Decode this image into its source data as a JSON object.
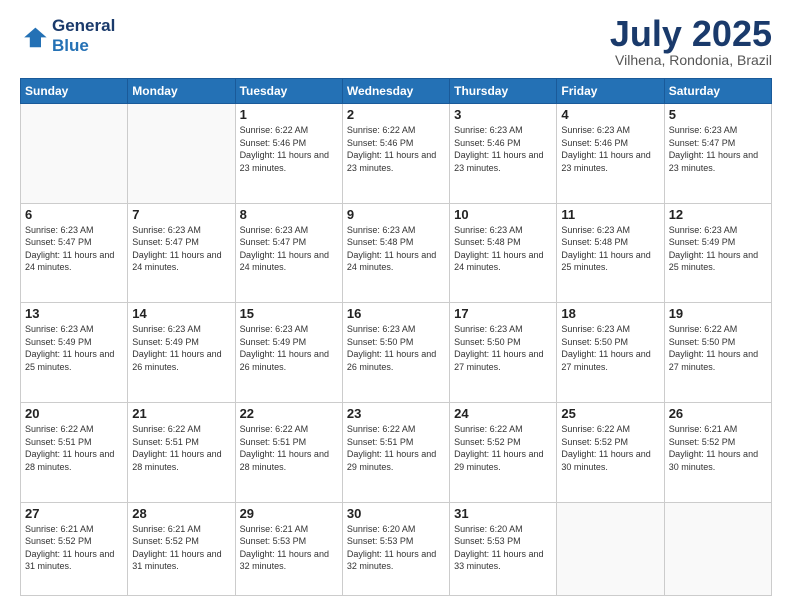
{
  "logo": {
    "line1": "General",
    "line2": "Blue"
  },
  "header": {
    "month": "July 2025",
    "location": "Vilhena, Rondonia, Brazil"
  },
  "weekdays": [
    "Sunday",
    "Monday",
    "Tuesday",
    "Wednesday",
    "Thursday",
    "Friday",
    "Saturday"
  ],
  "weeks": [
    [
      {
        "day": "",
        "info": ""
      },
      {
        "day": "",
        "info": ""
      },
      {
        "day": "1",
        "info": "Sunrise: 6:22 AM\nSunset: 5:46 PM\nDaylight: 11 hours and 23 minutes."
      },
      {
        "day": "2",
        "info": "Sunrise: 6:22 AM\nSunset: 5:46 PM\nDaylight: 11 hours and 23 minutes."
      },
      {
        "day": "3",
        "info": "Sunrise: 6:23 AM\nSunset: 5:46 PM\nDaylight: 11 hours and 23 minutes."
      },
      {
        "day": "4",
        "info": "Sunrise: 6:23 AM\nSunset: 5:46 PM\nDaylight: 11 hours and 23 minutes."
      },
      {
        "day": "5",
        "info": "Sunrise: 6:23 AM\nSunset: 5:47 PM\nDaylight: 11 hours and 23 minutes."
      }
    ],
    [
      {
        "day": "6",
        "info": "Sunrise: 6:23 AM\nSunset: 5:47 PM\nDaylight: 11 hours and 24 minutes."
      },
      {
        "day": "7",
        "info": "Sunrise: 6:23 AM\nSunset: 5:47 PM\nDaylight: 11 hours and 24 minutes."
      },
      {
        "day": "8",
        "info": "Sunrise: 6:23 AM\nSunset: 5:47 PM\nDaylight: 11 hours and 24 minutes."
      },
      {
        "day": "9",
        "info": "Sunrise: 6:23 AM\nSunset: 5:48 PM\nDaylight: 11 hours and 24 minutes."
      },
      {
        "day": "10",
        "info": "Sunrise: 6:23 AM\nSunset: 5:48 PM\nDaylight: 11 hours and 24 minutes."
      },
      {
        "day": "11",
        "info": "Sunrise: 6:23 AM\nSunset: 5:48 PM\nDaylight: 11 hours and 25 minutes."
      },
      {
        "day": "12",
        "info": "Sunrise: 6:23 AM\nSunset: 5:49 PM\nDaylight: 11 hours and 25 minutes."
      }
    ],
    [
      {
        "day": "13",
        "info": "Sunrise: 6:23 AM\nSunset: 5:49 PM\nDaylight: 11 hours and 25 minutes."
      },
      {
        "day": "14",
        "info": "Sunrise: 6:23 AM\nSunset: 5:49 PM\nDaylight: 11 hours and 26 minutes."
      },
      {
        "day": "15",
        "info": "Sunrise: 6:23 AM\nSunset: 5:49 PM\nDaylight: 11 hours and 26 minutes."
      },
      {
        "day": "16",
        "info": "Sunrise: 6:23 AM\nSunset: 5:50 PM\nDaylight: 11 hours and 26 minutes."
      },
      {
        "day": "17",
        "info": "Sunrise: 6:23 AM\nSunset: 5:50 PM\nDaylight: 11 hours and 27 minutes."
      },
      {
        "day": "18",
        "info": "Sunrise: 6:23 AM\nSunset: 5:50 PM\nDaylight: 11 hours and 27 minutes."
      },
      {
        "day": "19",
        "info": "Sunrise: 6:22 AM\nSunset: 5:50 PM\nDaylight: 11 hours and 27 minutes."
      }
    ],
    [
      {
        "day": "20",
        "info": "Sunrise: 6:22 AM\nSunset: 5:51 PM\nDaylight: 11 hours and 28 minutes."
      },
      {
        "day": "21",
        "info": "Sunrise: 6:22 AM\nSunset: 5:51 PM\nDaylight: 11 hours and 28 minutes."
      },
      {
        "day": "22",
        "info": "Sunrise: 6:22 AM\nSunset: 5:51 PM\nDaylight: 11 hours and 28 minutes."
      },
      {
        "day": "23",
        "info": "Sunrise: 6:22 AM\nSunset: 5:51 PM\nDaylight: 11 hours and 29 minutes."
      },
      {
        "day": "24",
        "info": "Sunrise: 6:22 AM\nSunset: 5:52 PM\nDaylight: 11 hours and 29 minutes."
      },
      {
        "day": "25",
        "info": "Sunrise: 6:22 AM\nSunset: 5:52 PM\nDaylight: 11 hours and 30 minutes."
      },
      {
        "day": "26",
        "info": "Sunrise: 6:21 AM\nSunset: 5:52 PM\nDaylight: 11 hours and 30 minutes."
      }
    ],
    [
      {
        "day": "27",
        "info": "Sunrise: 6:21 AM\nSunset: 5:52 PM\nDaylight: 11 hours and 31 minutes."
      },
      {
        "day": "28",
        "info": "Sunrise: 6:21 AM\nSunset: 5:52 PM\nDaylight: 11 hours and 31 minutes."
      },
      {
        "day": "29",
        "info": "Sunrise: 6:21 AM\nSunset: 5:53 PM\nDaylight: 11 hours and 32 minutes."
      },
      {
        "day": "30",
        "info": "Sunrise: 6:20 AM\nSunset: 5:53 PM\nDaylight: 11 hours and 32 minutes."
      },
      {
        "day": "31",
        "info": "Sunrise: 6:20 AM\nSunset: 5:53 PM\nDaylight: 11 hours and 33 minutes."
      },
      {
        "day": "",
        "info": ""
      },
      {
        "day": "",
        "info": ""
      }
    ]
  ]
}
